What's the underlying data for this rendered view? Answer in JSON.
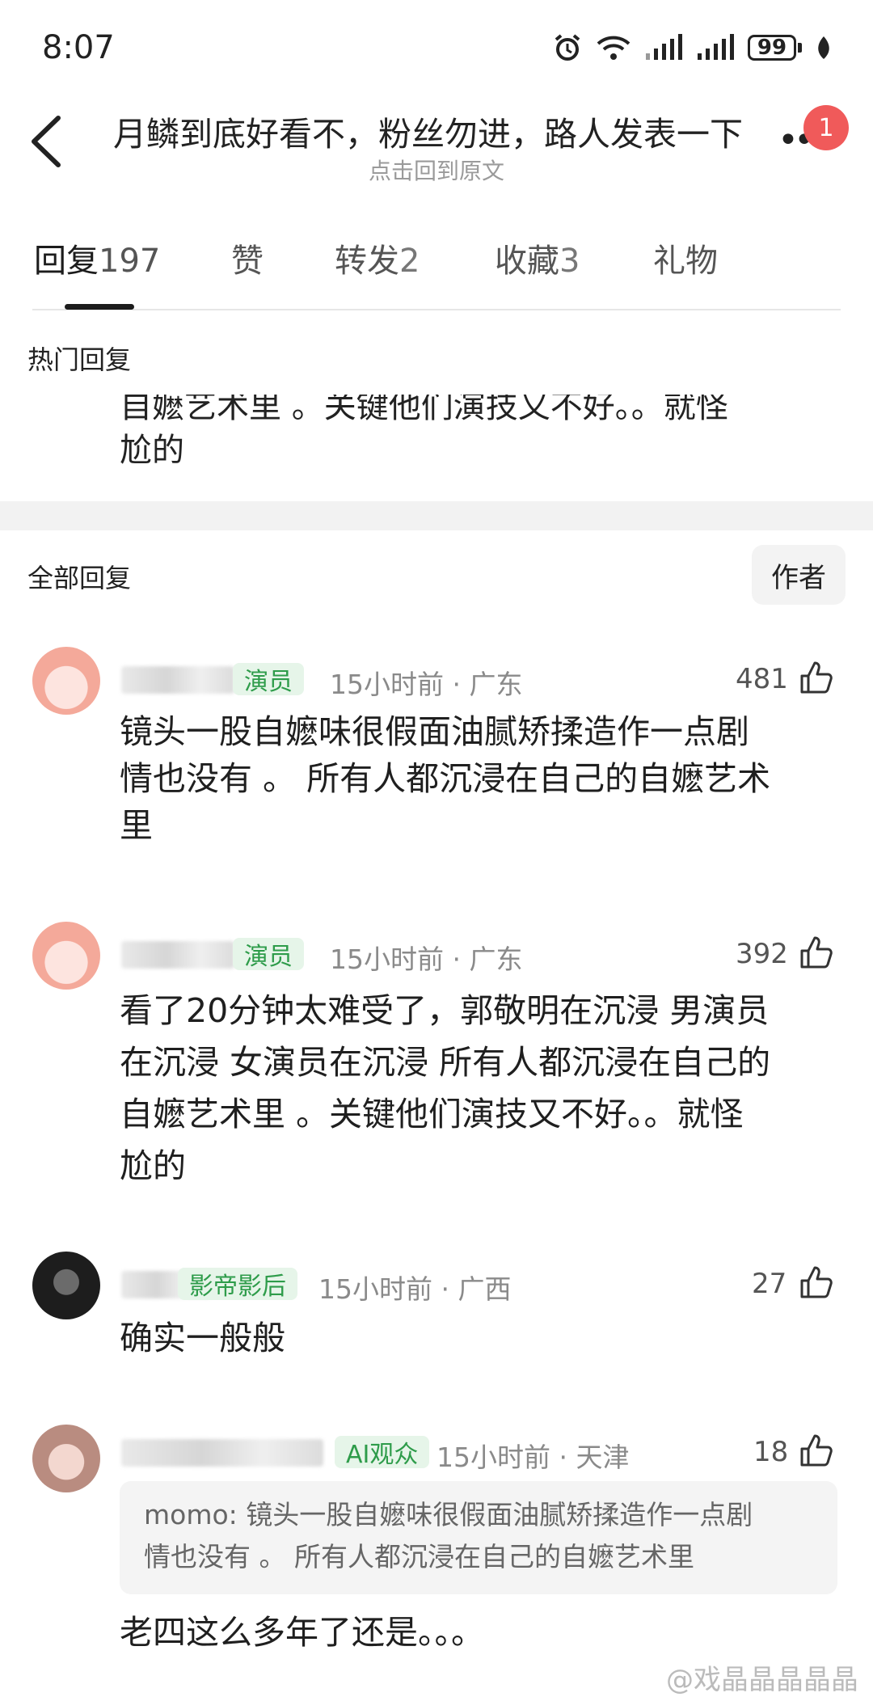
{
  "status_bar": {
    "time": "8:07",
    "battery": "99"
  },
  "header": {
    "title": "月鳞到底好看不，粉丝勿进，路人发表一下",
    "subtitle": "点击回到原文",
    "notification_count": "1"
  },
  "tabs": [
    {
      "label": "回复",
      "count": "197"
    },
    {
      "label": "赞",
      "count": ""
    },
    {
      "label": "转发",
      "count": "2"
    },
    {
      "label": "收藏",
      "count": "3"
    },
    {
      "label": "礼物",
      "count": ""
    }
  ],
  "hot_section": {
    "label": "热门回复",
    "clipped_text": "自嬷艺术里 。关键他们演技又不好。。就怪",
    "tail_text": "尬的"
  },
  "all_section": {
    "label": "全部回复",
    "author_button": "作者"
  },
  "comments": [
    {
      "badge": "演员",
      "time_location": "15小时前 · 广东",
      "likes": "481",
      "text_lines": [
        "镜头一股自嬷味很假面油腻矫揉造作一点剧",
        "情也没有 。 所有人都沉浸在自己的自嬷艺术",
        "里"
      ]
    },
    {
      "badge": "演员",
      "time_location": "15小时前 · 广东",
      "likes": "392",
      "text_lines": [
        "看了20分钟太难受了，郭敬明在沉浸 男演员",
        "在沉浸 女演员在沉浸 所有人都沉浸在自己的",
        "自嬷艺术里 。关键他们演技又不好。。就怪",
        "尬的"
      ]
    },
    {
      "badge": "影帝影后",
      "time_location": "15小时前 · 广西",
      "likes": "27",
      "text_lines": [
        "确实一般般"
      ]
    },
    {
      "badge": "AI观众",
      "time_location": "15小时前 · 天津",
      "likes": "18",
      "quote": [
        "momo: 镜头一股自嬷味很假面油腻矫揉造作一点剧",
        "情也没有 。 所有人都沉浸在自己的自嬷艺术里"
      ],
      "text_lines": [
        "老四这么多年了还是。。。"
      ]
    }
  ],
  "watermark": "@戏晶晶晶晶晶"
}
